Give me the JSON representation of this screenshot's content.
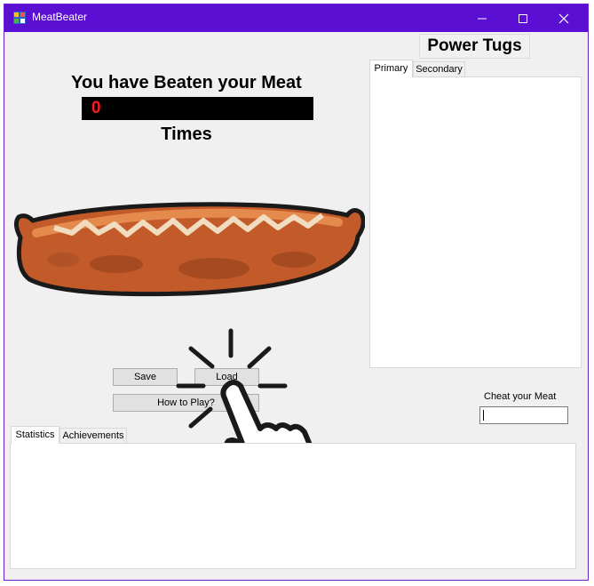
{
  "window": {
    "title": "MeatBeater",
    "accent": "#5a0fd3",
    "icons": [
      "app-icon",
      "minimize-icon",
      "maximize-icon",
      "close-icon"
    ]
  },
  "counter": {
    "label_top": "You have Beaten your Meat",
    "value": "0",
    "label_bottom": "Times",
    "value_color": "#ff1a1a"
  },
  "buttons": {
    "save": "Save",
    "load": "Load",
    "how_to_play": "How to Play?"
  },
  "power_tugs": {
    "title": "Power Tugs",
    "tabs": [
      "Primary",
      "Secondary"
    ],
    "active_tab": "Primary"
  },
  "cheat": {
    "label": "Cheat your Meat",
    "value": ""
  },
  "bottom_tabs": {
    "tabs": [
      "Statistics",
      "Achievements"
    ],
    "active_tab": "Statistics"
  },
  "images": {
    "sausage": "sausage-image",
    "cursor": "hand-pointer-cursor-icon"
  }
}
